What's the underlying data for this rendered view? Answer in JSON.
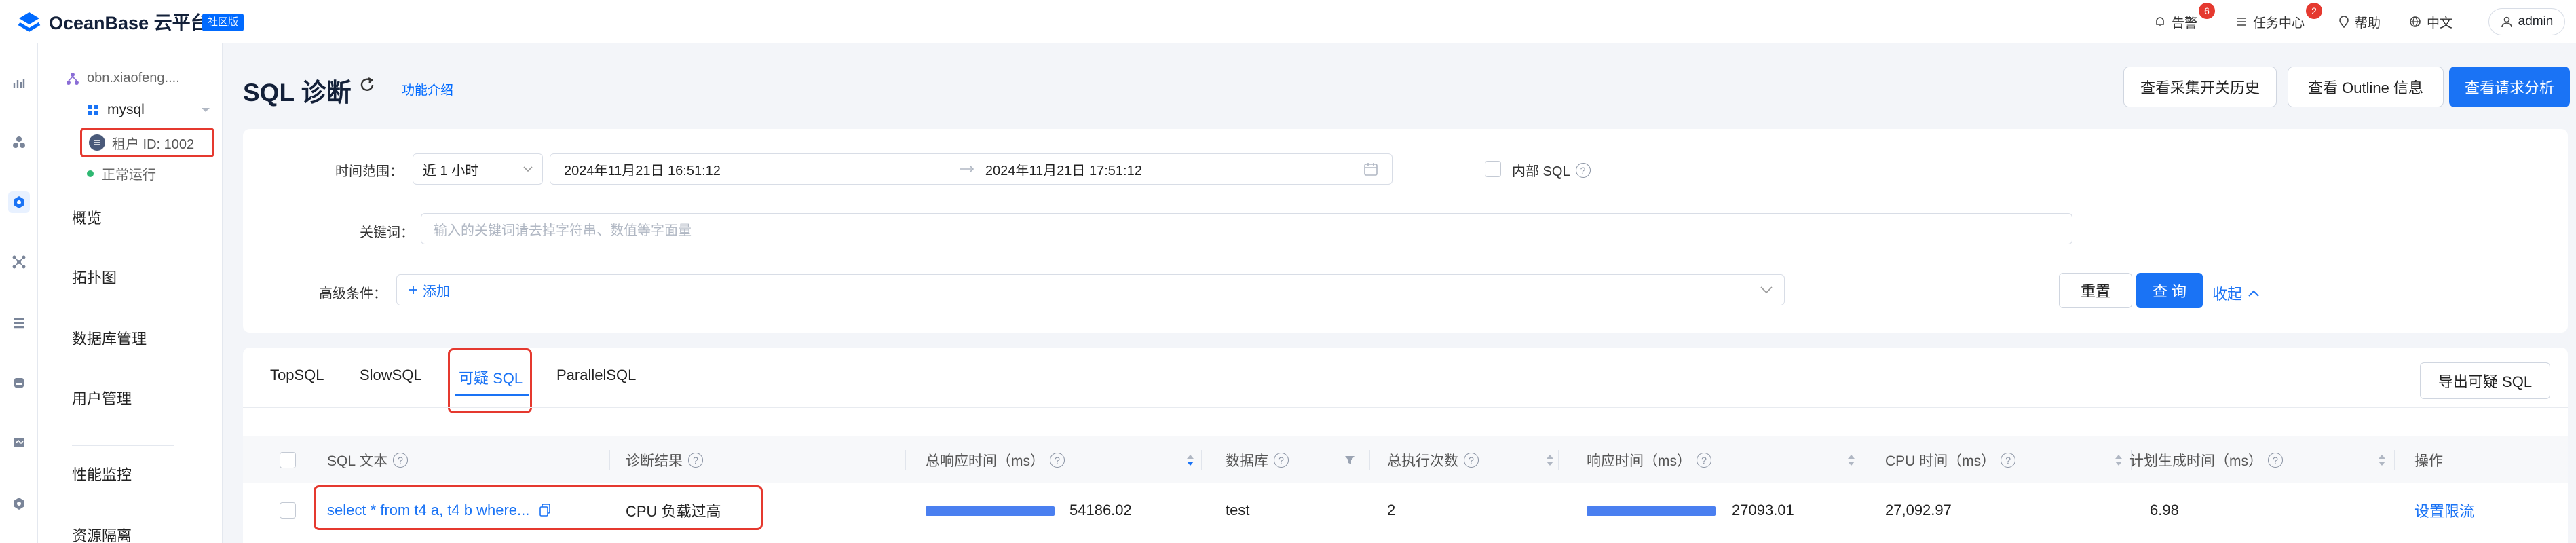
{
  "brand": {
    "name": "OceanBase 云平台",
    "edition": "社区版"
  },
  "topbar": {
    "alerts": {
      "label": "告警",
      "count": "6"
    },
    "tasks": {
      "label": "任务中心",
      "count": "2"
    },
    "help": "帮助",
    "language": "中文",
    "user": "admin"
  },
  "sidebar": {
    "cluster": "obn.xiaofeng....",
    "tenant": "mysql",
    "tenant_id": "租户 ID: 1002",
    "status": "正常运行",
    "items": [
      "概览",
      "拓扑图",
      "数据库管理",
      "用户管理",
      "性能监控",
      "资源隔离"
    ]
  },
  "page": {
    "title": "SQL 诊断",
    "intro_link": "功能介绍",
    "actions": [
      "查看采集开关历史",
      "查看 Outline 信息",
      "查看请求分析"
    ]
  },
  "filters": {
    "time_range_label": "时间范围：",
    "time_range_value": "近 1 小时",
    "start_time": "2024年11月21日 16:51:12",
    "end_time": "2024年11月21日 17:51:12",
    "internal_sql_label": "内部 SQL",
    "keyword_label": "关键词：",
    "keyword_placeholder": "输入的关键词请去掉字符串、数值等字面量",
    "advanced_label": "高级条件：",
    "add_label": "添加",
    "reset": "重置",
    "query": "查 询",
    "collapse": "收起"
  },
  "tabs": [
    "TopSQL",
    "SlowSQL",
    "可疑 SQL",
    "ParallelSQL"
  ],
  "export_button": "导出可疑 SQL",
  "table": {
    "columns": [
      "SQL 文本",
      "诊断结果",
      "总响应时间（ms）",
      "数据库",
      "总执行次数",
      "响应时间（ms）",
      "CPU 时间（ms）",
      "计划生成时间（ms）",
      "操作"
    ],
    "rows": [
      {
        "sql_text": "select * from t4 a, t4 b where...",
        "diagnosis": "CPU 负载过高",
        "total_response_time": "54186.02",
        "database": "test",
        "total_executions": "2",
        "response_time": "27093.01",
        "cpu_time": "27,092.97",
        "plan_gen_time": "6.98",
        "action": "设置限流"
      }
    ]
  },
  "colors": {
    "accent": "#1a73f5",
    "highlight": "#e5392f",
    "status_ok": "#2eb872"
  }
}
